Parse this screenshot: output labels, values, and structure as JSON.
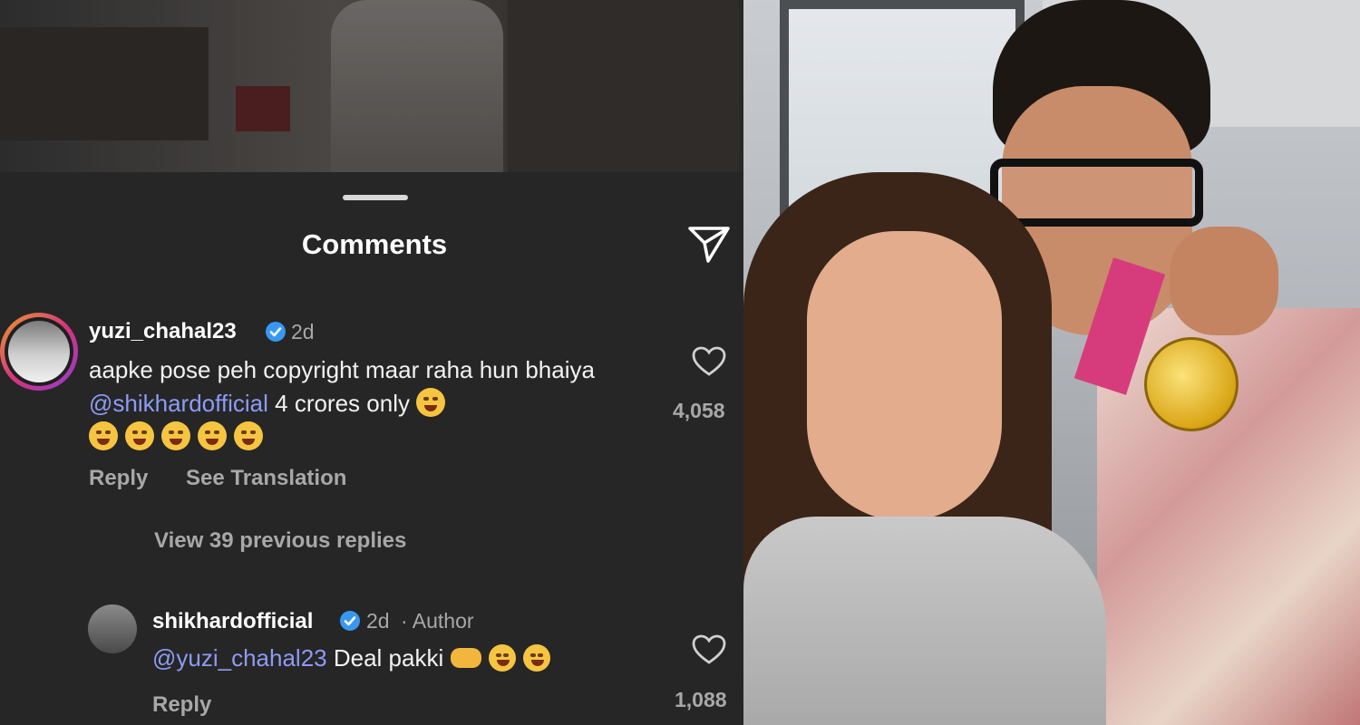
{
  "sheet": {
    "title": "Comments",
    "share_icon": "send-icon"
  },
  "comments": [
    {
      "username": "yuzi_chahal23",
      "verified": true,
      "time": "2d",
      "text_before": "aapke pose peh copyright maar raha hun bhaiya ",
      "mention": "@shikhardofficial",
      "text_after": " 4 crores only",
      "emojis": [
        "rolling-on-floor-laughing",
        "rolling-on-floor-laughing",
        "rolling-on-floor-laughing",
        "face-with-tears-of-joy",
        "face-with-tears-of-joy",
        "face-with-tears-of-joy"
      ],
      "reply_label": "Reply",
      "translate_label": "See Translation",
      "likes": "4,058"
    }
  ],
  "view_replies": "View 39 previous replies",
  "reply": {
    "username": "shikhardofficial",
    "verified": true,
    "time": "2d",
    "author_tag": "· Author",
    "mention": "@yuzi_chahal23",
    "text": " Deal pakki",
    "emojis": [
      "handshake",
      "rolling-on-floor-laughing",
      "winking-face"
    ],
    "reply_label": "Reply",
    "likes": "1,088"
  },
  "colors": {
    "background": "#262626",
    "mention": "#8e9bf5",
    "verified": "#3897f0",
    "muted": "#a8a8a8"
  }
}
